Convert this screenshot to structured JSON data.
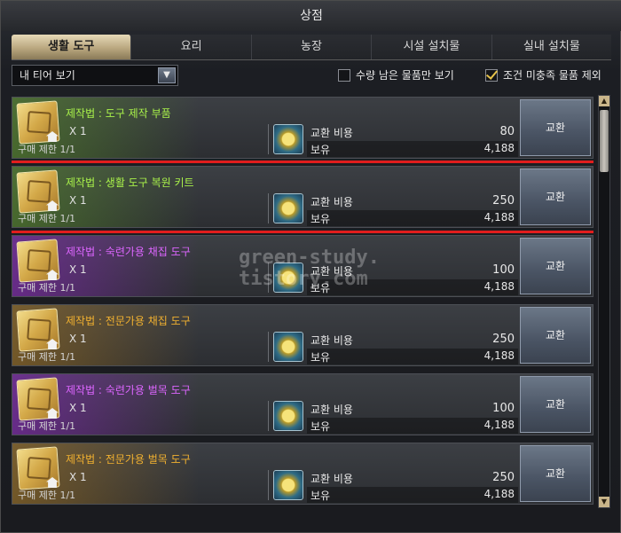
{
  "window": {
    "title": "상점"
  },
  "tabs": [
    "생활 도구",
    "요리",
    "농장",
    "시설 설치물",
    "실내 설치물"
  ],
  "filter": {
    "tier_select": "내 티어 보기",
    "only_remaining_label": "수량 남은 물품만 보기",
    "only_remaining_checked": false,
    "exclude_unmet_label": "조건 미충족 물품 제외",
    "exclude_unmet_checked": true
  },
  "labels": {
    "cost": "교환 비용",
    "own": "보유",
    "exchange": "교환"
  },
  "items": [
    {
      "name": "제작법 : 도구 제작 부품",
      "qty": "X 1",
      "limit": "구매 제한 1/1",
      "cost": "80",
      "own": "4,188",
      "grade": "green"
    },
    {
      "name": "제작법 : 생활 도구 복원 키트",
      "qty": "X 1",
      "limit": "구매 제한 1/1",
      "cost": "250",
      "own": "4,188",
      "grade": "green"
    },
    {
      "name": "제작법 : 숙련가용 채집 도구",
      "qty": "X 1",
      "limit": "구매 제한 1/1",
      "cost": "100",
      "own": "4,188",
      "grade": "purple"
    },
    {
      "name": "제작법 : 전문가용 채집 도구",
      "qty": "X 1",
      "limit": "구매 제한 1/1",
      "cost": "250",
      "own": "4,188",
      "grade": "gold"
    },
    {
      "name": "제작법 : 숙련가용 벌목 도구",
      "qty": "X 1",
      "limit": "구매 제한 1/1",
      "cost": "100",
      "own": "4,188",
      "grade": "purple"
    },
    {
      "name": "제작법 : 전문가용 벌목 도구",
      "qty": "X 1",
      "limit": "구매 제한 1/1",
      "cost": "250",
      "own": "4,188",
      "grade": "gold"
    }
  ],
  "watermark": "green-study.\ntistory.com",
  "colors": {
    "green_grade": "#a8f04a",
    "purple_grade": "#dd66ff",
    "gold_grade": "#f0b030",
    "highlight": "#e11d1d"
  }
}
